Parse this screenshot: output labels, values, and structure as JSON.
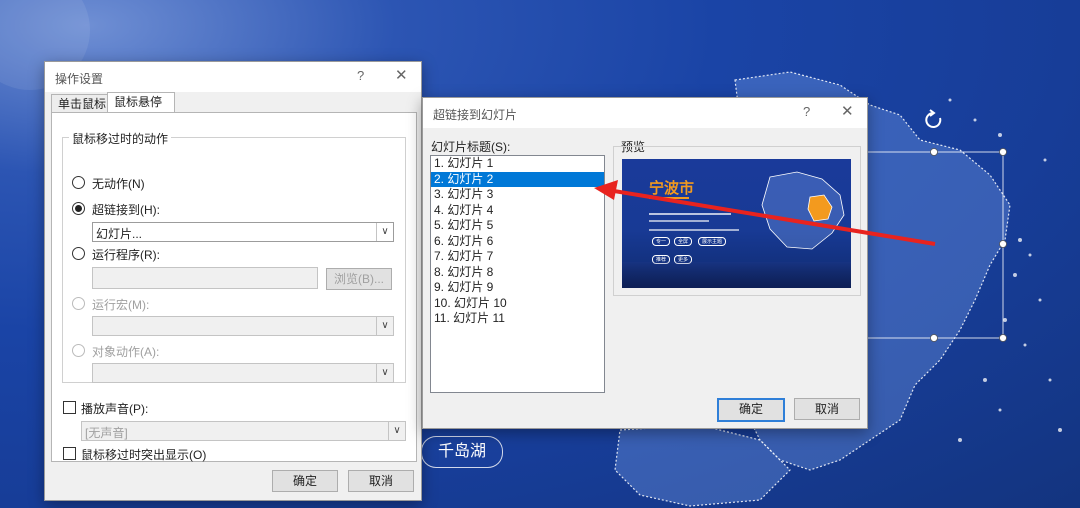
{
  "background": {
    "place_label": "千岛湖"
  },
  "action_dialog": {
    "title": "操作设置",
    "help": "?",
    "close": "✕",
    "tabs": [
      {
        "label": "单击鼠标"
      },
      {
        "label": "鼠标悬停"
      }
    ],
    "group_title": "鼠标移过时的动作",
    "no_action": "无动作(N)",
    "hyperlink_to": "超链接到(H):",
    "hyperlink_value": "幻灯片...",
    "run_program": "运行程序(R):",
    "browse": "浏览(B)...",
    "run_macro": "运行宏(M):",
    "object_action": "对象动作(A):",
    "play_sound": "播放声音(P):",
    "sound_value": "[无声音]",
    "highlight": "鼠标移过时突出显示(O)",
    "ok": "确定",
    "cancel": "取消"
  },
  "slide_dialog": {
    "title": "超链接到幻灯片",
    "help": "?",
    "close": "✕",
    "list_label": "幻灯片标题(S):",
    "preview_label": "预览",
    "slides": [
      "1. 幻灯片 1",
      "2. 幻灯片 2",
      "3. 幻灯片 3",
      "4. 幻灯片 4",
      "5. 幻灯片 5",
      "6. 幻灯片 6",
      "7. 幻灯片 7",
      "8. 幻灯片 8",
      "9. 幻灯片 9",
      "10. 幻灯片 10",
      "11. 幻灯片 11"
    ],
    "selected_index": 1,
    "preview": {
      "title": "宁波市",
      "buttons": [
        "专一",
        "全屏",
        "展示主题",
        "推荐",
        "更多"
      ]
    },
    "ok": "确定",
    "cancel": "取消"
  },
  "colors": {
    "selection": "#0078d7",
    "arrow": "#e8231f",
    "background": "#1a44a6",
    "highlight": "#f39a1e"
  }
}
